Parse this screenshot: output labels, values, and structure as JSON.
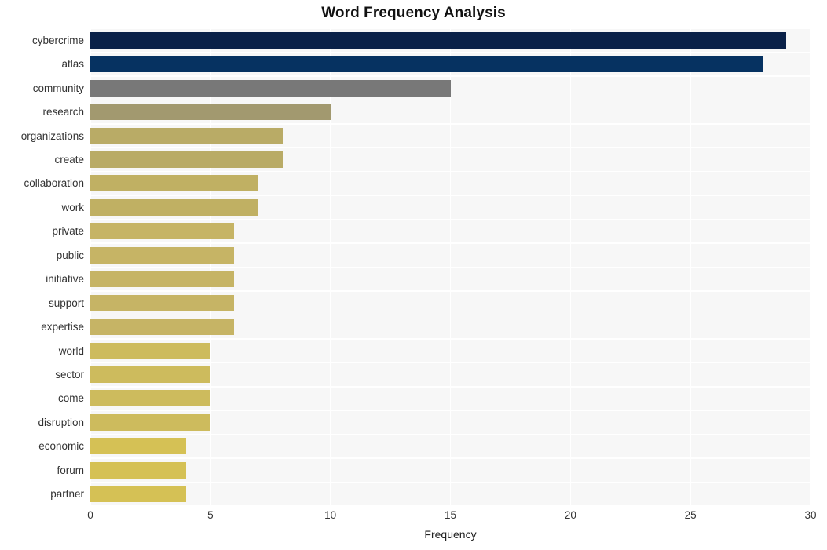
{
  "chart_data": {
    "type": "bar",
    "orientation": "horizontal",
    "title": "Word Frequency Analysis",
    "xlabel": "Frequency",
    "ylabel": "",
    "xlim": [
      0,
      30
    ],
    "xticks": [
      0,
      5,
      10,
      15,
      20,
      25,
      30
    ],
    "grid": true,
    "legend": null,
    "categories": [
      "cybercrime",
      "atlas",
      "community",
      "research",
      "organizations",
      "create",
      "collaboration",
      "work",
      "private",
      "public",
      "initiative",
      "support",
      "expertise",
      "world",
      "sector",
      "come",
      "disruption",
      "economic",
      "forum",
      "partner"
    ],
    "values": [
      29,
      28,
      15,
      10,
      8,
      8,
      7,
      7,
      6,
      6,
      6,
      6,
      6,
      5,
      5,
      5,
      5,
      4,
      4,
      4
    ],
    "bar_colors": [
      "#0a2148",
      "#063261",
      "#787878",
      "#a2996f",
      "#b9ab66",
      "#b9ab66",
      "#c0b063",
      "#c0b063",
      "#c6b465",
      "#c6b465",
      "#c6b465",
      "#c6b465",
      "#c6b465",
      "#cdbb5d",
      "#cdbb5d",
      "#cdbb5d",
      "#cdbb5d",
      "#d5c155",
      "#d5c155",
      "#d5c155"
    ]
  },
  "style": {
    "plot_background": "#f7f7f7",
    "grid_color": "#ffffff",
    "figure_background": "#ffffff",
    "tick_text_color": "#333333",
    "title_color": "#111111"
  }
}
